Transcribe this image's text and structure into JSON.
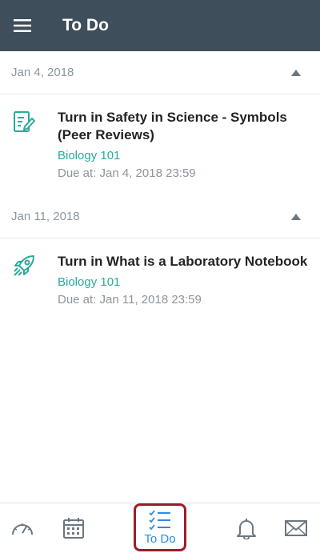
{
  "appbar": {
    "title": "To Do",
    "menu_icon": "hamburger-icon"
  },
  "sections": [
    {
      "date": "Jan 4, 2018",
      "items": [
        {
          "title": "Turn in Safety in Science - Symbols (Peer Reviews)",
          "course": "Biology 101",
          "due": "Due at: Jan 4, 2018 23:59",
          "icon": "assignment-edit-icon"
        }
      ]
    },
    {
      "date": "Jan 11, 2018",
      "items": [
        {
          "title": "Turn in What is a Laboratory Notebook",
          "course": "Biology 101",
          "due": "Due at: Jan 11, 2018 23:59",
          "icon": "rocket-icon"
        }
      ]
    }
  ],
  "tabbar": {
    "tabs": [
      {
        "name": "dashboard",
        "icon": "dashboard-gauge-icon"
      },
      {
        "name": "calendar",
        "icon": "calendar-icon"
      },
      {
        "name": "todo",
        "icon": "checklist-icon",
        "label": "To Do",
        "active": true
      },
      {
        "name": "notifications",
        "icon": "bell-icon"
      },
      {
        "name": "inbox",
        "icon": "mail-icon"
      }
    ]
  },
  "colors": {
    "appbar": "#3f4e5b",
    "accent": "#2aa99b",
    "active_tab": "#2a8ee0",
    "highlight_border": "#9b1d2a"
  }
}
